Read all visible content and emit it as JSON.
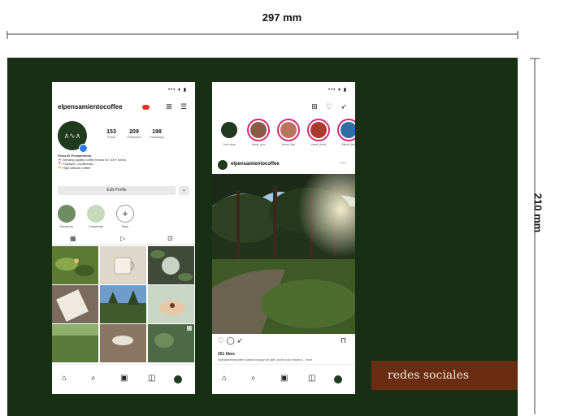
{
  "dimensions": {
    "width_label": "297 mm",
    "height_label": "210 mm"
  },
  "colors": {
    "board": "#173013",
    "accent_box": "#6b2d12",
    "story_ring": "#d62976",
    "badge": "#e5322b"
  },
  "profile_screen": {
    "status_icons": "••• ▾ ▮",
    "username": "elpensamientocoffee",
    "header_icons": [
      "plus-square-icon",
      "menu-icon"
    ],
    "avatar_text": "∧∿∧",
    "stats": [
      {
        "value": "153",
        "label": "Posts"
      },
      {
        "value": "209",
        "label": "Followers"
      },
      {
        "value": "198",
        "label": "Following"
      }
    ],
    "bio_lines": [
      "Finca El Pensamiento",
      "☕ Brewing quality coffee beans for 100+ years",
      "📍 Popayan, Guatemala",
      "🌱 High altitude coffee"
    ],
    "edit_button": "Edit Profile",
    "edit_more": "⌄",
    "highlights": [
      {
        "label": "Nosotros",
        "color": "#6f8c63"
      },
      {
        "label": "Cosechas",
        "color": "#c5dbbc"
      },
      {
        "label": "New",
        "color": "#ffffff"
      }
    ],
    "tabs": [
      "grid-icon",
      "reels-icon",
      "tagged-icon"
    ],
    "grid_tiles": [
      {
        "kind": "coffee-plant",
        "color": "#5b7a34"
      },
      {
        "kind": "mug",
        "color": "#ded7cc"
      },
      {
        "kind": "leaves",
        "color": "#3f4a39"
      },
      {
        "kind": "paper-bag",
        "color": "#7a6b5c"
      },
      {
        "kind": "forest-sky",
        "color": "#6f9cc9"
      },
      {
        "kind": "hands-bean",
        "color": "#c9d6c5"
      },
      {
        "kind": "green-field",
        "color": "#5a7a3b"
      },
      {
        "kind": "cup",
        "color": "#8a7560"
      },
      {
        "kind": "foliage",
        "color": "#4c6a46"
      }
    ],
    "bottom_nav": [
      "home-icon",
      "search-icon",
      "reels-icon",
      "shop-icon",
      "profile-icon"
    ]
  },
  "feed_screen": {
    "status_icons": "••• ▾ ▮",
    "header_icons": [
      "plus-square-icon",
      "heart-icon",
      "send-icon"
    ],
    "stories": [
      {
        "label": "Your story",
        "color": "#1f3a1c"
      },
      {
        "label": "friend_one",
        "color": "#8a5a44"
      },
      {
        "label": "friend_two",
        "color": "#b8745c"
      },
      {
        "label": "friend_three",
        "color": "#a83a2e"
      },
      {
        "label": "friend_four",
        "color": "#2f6ea5"
      }
    ],
    "post_user": "elpensamientocoffee",
    "post_more": "⋯",
    "actions": [
      "heart-icon",
      "comment-icon",
      "send-icon",
      "bookmark-icon"
    ],
    "likes": "251 likes",
    "caption": "elpensamientocoffee  Nuestro bosque de cafe, donde todo empieza... more",
    "bottom_nav": [
      "home-icon",
      "search-icon",
      "reels-icon",
      "shop-icon",
      "profile-icon"
    ]
  },
  "tag": {
    "text": "redes sociales"
  }
}
